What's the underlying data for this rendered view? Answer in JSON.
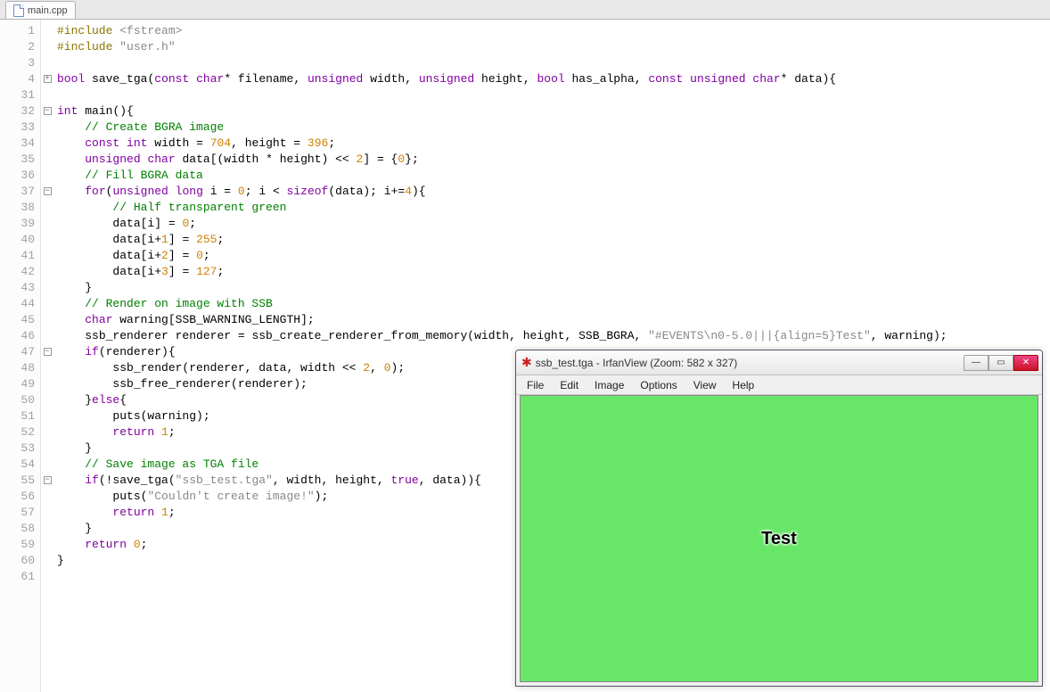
{
  "tab": {
    "filename": "main.cpp"
  },
  "gutter_lines": [
    "1",
    "2",
    "3",
    "4",
    "31",
    "32",
    "33",
    "34",
    "35",
    "36",
    "37",
    "38",
    "39",
    "40",
    "41",
    "42",
    "43",
    "44",
    "45",
    "46",
    "47",
    "48",
    "49",
    "50",
    "51",
    "52",
    "53",
    "54",
    "55",
    "56",
    "57",
    "58",
    "59",
    "60",
    "61"
  ],
  "fold_markers": {
    "3": "+",
    "5": "-",
    "10": "-",
    "20": "-",
    "28": "-"
  },
  "code": {
    "l1": {
      "pp": "#include ",
      "str": "<fstream>"
    },
    "l2": {
      "pp": "#include ",
      "str": "\"user.h\""
    },
    "l3": {
      "raw": ""
    },
    "l4": {
      "kw1": "bool",
      "sp1": " ",
      "id1": "save_tga",
      "op1": "(",
      "kw2": "const",
      "sp2": " ",
      "kw3": "char",
      "op2": "* ",
      "id2": "filename",
      "op3": ", ",
      "kw4": "unsigned",
      "sp3": " ",
      "id3": "width",
      "op4": ", ",
      "kw5": "unsigned",
      "sp4": " ",
      "id4": "height",
      "op5": ", ",
      "kw6": "bool",
      "sp5": " ",
      "id5": "has_alpha",
      "op6": ", ",
      "kw7": "const",
      "sp6": " ",
      "kw8": "unsigned",
      "sp7": " ",
      "kw9": "char",
      "op7": "* ",
      "id6": "data",
      "op8": "){"
    },
    "l5": {
      "raw": ""
    },
    "l6": {
      "kw1": "int",
      "sp1": " ",
      "id1": "main",
      "op1": "(){"
    },
    "l7": {
      "cmt": "    // Create BGRA image"
    },
    "l8": {
      "pad": "    ",
      "kw1": "const",
      "sp1": " ",
      "kw2": "int",
      "sp2": " ",
      "id1": "width = ",
      "num1": "704",
      "op1": ", ",
      "id2": "height = ",
      "num2": "396",
      "op2": ";"
    },
    "l9": {
      "pad": "    ",
      "kw1": "unsigned",
      "sp1": " ",
      "kw2": "char",
      "sp2": " ",
      "id1": "data[(width * height) << ",
      "num1": "2",
      "op1": "] = {",
      "num2": "0",
      "op2": "};"
    },
    "l10": {
      "cmt": "    // Fill BGRA data"
    },
    "l11": {
      "pad": "    ",
      "kw1": "for",
      "op1": "(",
      "kw2": "unsigned",
      "sp1": " ",
      "kw3": "long",
      "sp2": " ",
      "id1": "i = ",
      "num1": "0",
      "op2": "; i < ",
      "kw4": "sizeof",
      "op3": "(data); i+=",
      "num2": "4",
      "op4": "){"
    },
    "l12": {
      "cmt": "        // Half transparent green"
    },
    "l13": {
      "pad": "        ",
      "id1": "data[i] = ",
      "num1": "0",
      "op1": ";"
    },
    "l14": {
      "pad": "        ",
      "id1": "data[i+",
      "num1": "1",
      "id2": "] = ",
      "num2": "255",
      "op1": ";"
    },
    "l15": {
      "pad": "        ",
      "id1": "data[i+",
      "num1": "2",
      "id2": "] = ",
      "num2": "0",
      "op1": ";"
    },
    "l16": {
      "pad": "        ",
      "id1": "data[i+",
      "num1": "3",
      "id2": "] = ",
      "num2": "127",
      "op1": ";"
    },
    "l17": {
      "pad": "    ",
      "op1": "}"
    },
    "l18": {
      "cmt": "    // Render on image with SSB"
    },
    "l19": {
      "pad": "    ",
      "kw1": "char",
      "sp1": " ",
      "id1": "warning[SSB_WARNING_LENGTH];"
    },
    "l20": {
      "pad": "    ",
      "id1": "ssb_renderer renderer = ssb_create_renderer_from_memory(width, height, SSB_BGRA, ",
      "str": "\"#EVENTS\\n0-5.0|||{align=5}Test\"",
      "id2": ", warning);"
    },
    "l21": {
      "pad": "    ",
      "kw1": "if",
      "op1": "(renderer){"
    },
    "l22": {
      "pad": "        ",
      "id1": "ssb_render(renderer, data, width << ",
      "num1": "2",
      "id2": ", ",
      "num2": "0",
      "op1": ");"
    },
    "l23": {
      "pad": "        ",
      "id1": "ssb_free_renderer(renderer);"
    },
    "l24": {
      "pad": "    ",
      "op1": "}",
      "kw1": "else",
      "op2": "{"
    },
    "l25": {
      "pad": "        ",
      "id1": "puts(warning);"
    },
    "l26": {
      "pad": "        ",
      "kw1": "return",
      "sp1": " ",
      "num1": "1",
      "op1": ";"
    },
    "l27": {
      "pad": "    ",
      "op1": "}"
    },
    "l28": {
      "cmt": "    // Save image as TGA file"
    },
    "l29": {
      "pad": "    ",
      "kw1": "if",
      "op1": "(!save_tga(",
      "str": "\"ssb_test.tga\"",
      "id1": ", width, height, ",
      "kw2": "true",
      "id2": ", data)){"
    },
    "l30": {
      "pad": "        ",
      "id1": "puts(",
      "str": "\"Couldn't create image!\"",
      "op1": ");"
    },
    "l31": {
      "pad": "        ",
      "kw1": "return",
      "sp1": " ",
      "num1": "1",
      "op1": ";"
    },
    "l32": {
      "pad": "    ",
      "op1": "}"
    },
    "l33": {
      "pad": "    ",
      "kw1": "return",
      "sp1": " ",
      "num1": "0",
      "op1": ";"
    },
    "l34": {
      "op1": "}"
    },
    "l35": {
      "raw": ""
    }
  },
  "overlay": {
    "title": "ssb_test.tga - IrfanView (Zoom: 582 x 327)",
    "menu": [
      "File",
      "Edit",
      "Image",
      "Options",
      "View",
      "Help"
    ],
    "canvas_text": "Test",
    "canvas_bg": "#68E668"
  }
}
